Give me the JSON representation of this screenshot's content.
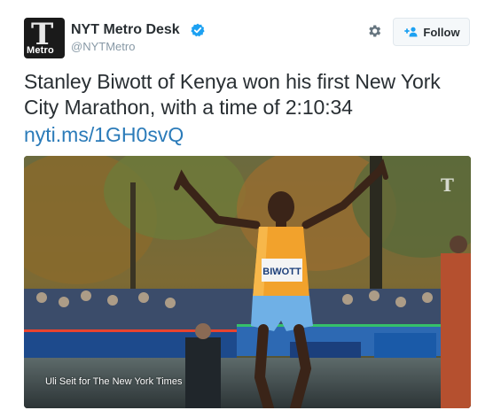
{
  "author": {
    "display_name": "NYT Metro Desk",
    "screen_name": "@NYTMetro",
    "avatar_label": "Metro",
    "avatar_glyph": "T",
    "verified": true
  },
  "actions": {
    "follow_label": "Follow"
  },
  "tweet": {
    "text": "Stanley Biwott of Kenya won his first New York City Marathon, with a time of 2:10:34",
    "link": "nyti.ms/1GH0svQ"
  },
  "photo": {
    "credit": "Uli Seit for The New York Times",
    "bib_name": "BIWOTT",
    "watermark_glyph": "T"
  },
  "colors": {
    "link": "#2b7bb9",
    "verified": "#1da1f2",
    "follow_icon": "#1da1f2",
    "muted": "#8899a6",
    "text": "#292f33"
  }
}
